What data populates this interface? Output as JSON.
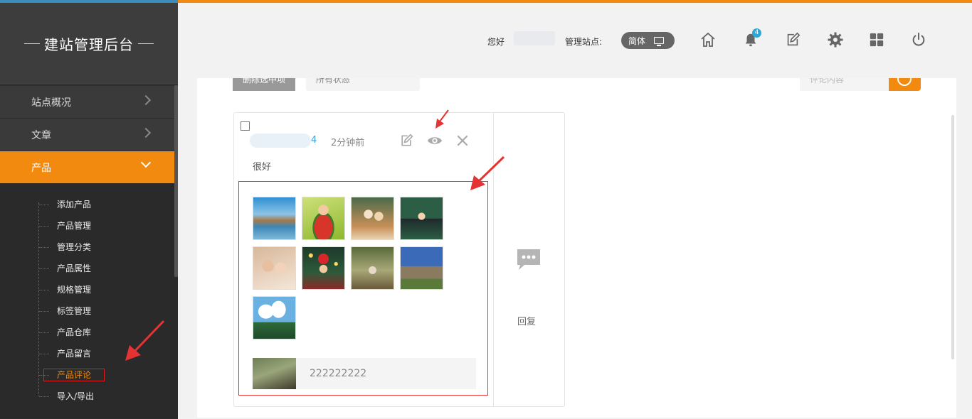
{
  "sidebar": {
    "brand": "建站管理后台",
    "menu": [
      {
        "label": "站点概况"
      },
      {
        "label": "文章"
      },
      {
        "label": "产品"
      }
    ],
    "submenu": [
      {
        "label": "添加产品"
      },
      {
        "label": "产品管理"
      },
      {
        "label": "管理分类"
      },
      {
        "label": "产品属性"
      },
      {
        "label": "规格管理"
      },
      {
        "label": "标签管理"
      },
      {
        "label": "产品仓库"
      },
      {
        "label": "产品留言"
      },
      {
        "label": "产品评论"
      },
      {
        "label": "导入/导出"
      }
    ]
  },
  "topbar": {
    "greeting": "您好",
    "site_label": "管理站点:",
    "language": "简体",
    "notification_count": "4",
    "icons": [
      "home-icon",
      "bell-icon",
      "edit-icon",
      "gear-icon",
      "apps-grid-icon",
      "power-icon"
    ]
  },
  "toolbar": {
    "delete_label": "删除选中项",
    "status_select": "所有状态",
    "search_placeholder": "评论内容"
  },
  "comment": {
    "user_suffix": "4",
    "time": "2分钟前",
    "text": "很好",
    "reply_text": "222222222",
    "reply_label": "回复"
  },
  "colors": {
    "accent": "#f28a10",
    "sidebar_bg": "#2e2e2e",
    "highlight_border": "#e02020",
    "link": "#3aa0d6"
  }
}
